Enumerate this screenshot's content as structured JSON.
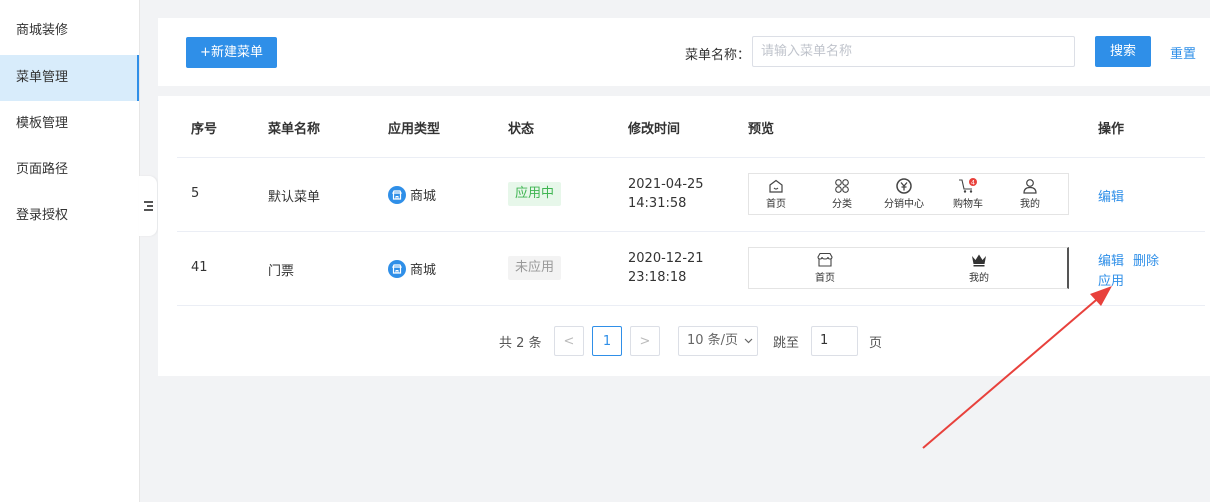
{
  "sidebar": {
    "items": [
      {
        "label": "商城装修"
      },
      {
        "label": "菜单管理"
      },
      {
        "label": "模板管理"
      },
      {
        "label": "页面路径"
      },
      {
        "label": "登录授权"
      }
    ],
    "active_index": 1
  },
  "toolbar": {
    "new_label": "+新建菜单",
    "search_label": "菜单名称：",
    "search_placeholder": "请输入菜单名称",
    "search_btn": "搜索",
    "reset": "重置"
  },
  "table": {
    "headers": [
      "序号",
      "菜单名称",
      "应用类型",
      "状态",
      "修改时间",
      "预览",
      "操作"
    ],
    "rows": [
      {
        "id": "5",
        "name": "默认菜单",
        "app_type": "商城",
        "status": "应用中",
        "time_date": "2021-04-25",
        "time_clock": "14:31:58",
        "preview": [
          {
            "label": "首页",
            "icon": "home-icon"
          },
          {
            "label": "分类",
            "icon": "category-icon"
          },
          {
            "label": "分销中心",
            "icon": "yen-icon"
          },
          {
            "label": "购物车",
            "icon": "cart-icon",
            "badge": "4"
          },
          {
            "label": "我的",
            "icon": "user-icon"
          }
        ],
        "ops": [
          "编辑"
        ]
      },
      {
        "id": "41",
        "name": "门票",
        "app_type": "商城",
        "status": "未应用",
        "time_date": "2020-12-21",
        "time_clock": "23:18:18",
        "preview": [
          {
            "label": "首页",
            "icon": "store-icon"
          },
          {
            "label": "我的",
            "icon": "crown-icon"
          }
        ],
        "ops": [
          "编辑",
          "删除",
          "应用"
        ]
      }
    ]
  },
  "pagination": {
    "total": "共 2 条",
    "prev": "<",
    "current": "1",
    "next": ">",
    "per_page": "10 条/页",
    "jump_prefix": "跳至",
    "jump_value": "1",
    "jump_suffix": "页"
  },
  "colors": {
    "accent": "#2f8fe8",
    "active_bg": "#d8ecfb",
    "status_on": "#3fb552",
    "annotation": "#e8413c"
  }
}
